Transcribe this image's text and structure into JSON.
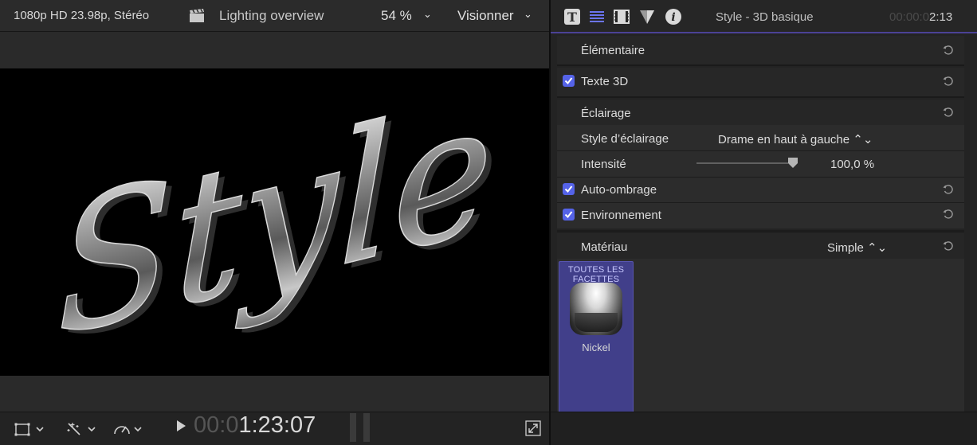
{
  "viewer": {
    "format": "1080p HD 23.98p, Stéréo",
    "clip_icon": "clapper-icon",
    "title": "Lighting overview",
    "zoom": "54 %",
    "view_menu": "Visionner",
    "canvas_text": "Style",
    "timecode_dim": "00:0",
    "timecode": "1:23:07"
  },
  "inspector": {
    "tabs": [
      "text-tab-icon",
      "paragraph-tab-icon",
      "video-tab-icon",
      "generator-tab-icon",
      "info-tab-icon"
    ],
    "title": "Style - 3D basique",
    "timecode_dim": "00:00:0",
    "timecode": "2:13",
    "rows": {
      "basic": "Élémentaire",
      "text3d": "Texte 3D",
      "lighting": "Éclairage",
      "lighting_style_label": "Style d’éclairage",
      "lighting_style_value": "Drame en haut à gauche ⌃⌄",
      "intensity_label": "Intensité",
      "intensity_value": "100,0 %",
      "intensity_level": 1.0,
      "self_shadow": "Auto-ombrage",
      "environment": "Environnement",
      "material_label": "Matériau",
      "material_value": "Simple ⌃⌄"
    },
    "material": {
      "tile_title": "TOUTES LES FACETTES",
      "name": "Nickel"
    }
  },
  "colors": {
    "accent": "#5563e8",
    "tile": "#413f8a"
  }
}
